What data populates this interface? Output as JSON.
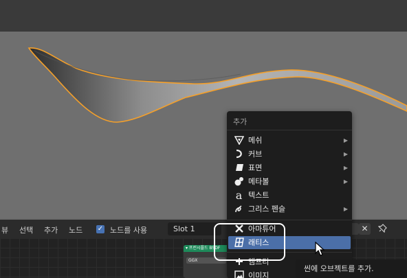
{
  "header": {
    "view_label": "뷰",
    "select_label": "선택",
    "add_label": "추가",
    "node_label": "노드",
    "use_nodes_label": "노드를 사용",
    "slot_value": "Slot 1",
    "close_glyph": "✕"
  },
  "node": {
    "title": "▾ 프린시플드 BSDF",
    "field": "GGX"
  },
  "menu": {
    "title": "추가",
    "items": [
      {
        "label": "메쉬",
        "icon": "mesh-icon",
        "submenu": true
      },
      {
        "label": "커브",
        "icon": "curve-icon",
        "submenu": true
      },
      {
        "label": "표면",
        "icon": "surface-icon",
        "submenu": true
      },
      {
        "label": "메타볼",
        "icon": "metaball-icon",
        "submenu": true
      },
      {
        "label": "텍스트",
        "icon": "text-icon",
        "submenu": false
      },
      {
        "label": "그리스 펜슬",
        "icon": "grease-pencil-icon",
        "submenu": true
      },
      {
        "label": "아마튜어",
        "icon": "armature-icon",
        "submenu": false
      },
      {
        "label": "래티스",
        "icon": "lattice-icon",
        "submenu": false,
        "active": true
      },
      {
        "label": "엠프티",
        "icon": "empty-icon",
        "submenu": true
      },
      {
        "label": "이미지",
        "icon": "image-icon",
        "submenu": true
      }
    ],
    "arrow": "▶"
  },
  "tooltip": {
    "text": "씬에 오브젝트를 추가."
  },
  "colors": {
    "accent": "#4b6fa8",
    "selection_outline": "#f5a02a",
    "node_header": "#1e8a5a"
  }
}
